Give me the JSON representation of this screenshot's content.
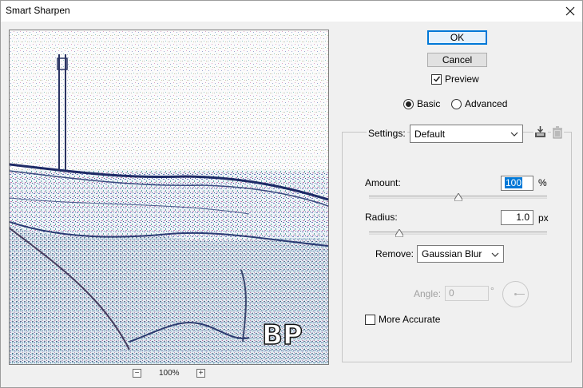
{
  "window": {
    "title": "Smart Sharpen"
  },
  "preview": {
    "zoom_level": "100%",
    "zoom_out_glyph": "−",
    "zoom_in_glyph": "+",
    "watermark_text": "BP"
  },
  "buttons": {
    "ok": "OK",
    "cancel": "Cancel"
  },
  "preview_checkbox": {
    "label": "Preview",
    "checked": true
  },
  "mode": {
    "options": [
      "Basic",
      "Advanced"
    ],
    "selected": "Basic"
  },
  "settings": {
    "label": "Settings:",
    "value": "Default"
  },
  "amount": {
    "label": "Amount:",
    "value": "100",
    "unit": "%",
    "slider_fraction": 0.5
  },
  "radius": {
    "label": "Radius:",
    "value": "1.0",
    "unit": "px",
    "slider_fraction": 0.17
  },
  "remove": {
    "label": "Remove:",
    "value": "Gaussian Blur"
  },
  "angle": {
    "label": "Angle:",
    "value": "0",
    "unit": "°",
    "enabled": false
  },
  "more_accurate": {
    "label": "More Accurate",
    "checked": false
  },
  "colors": {
    "accent": "#0078d7",
    "background": "#f0f0f0"
  }
}
